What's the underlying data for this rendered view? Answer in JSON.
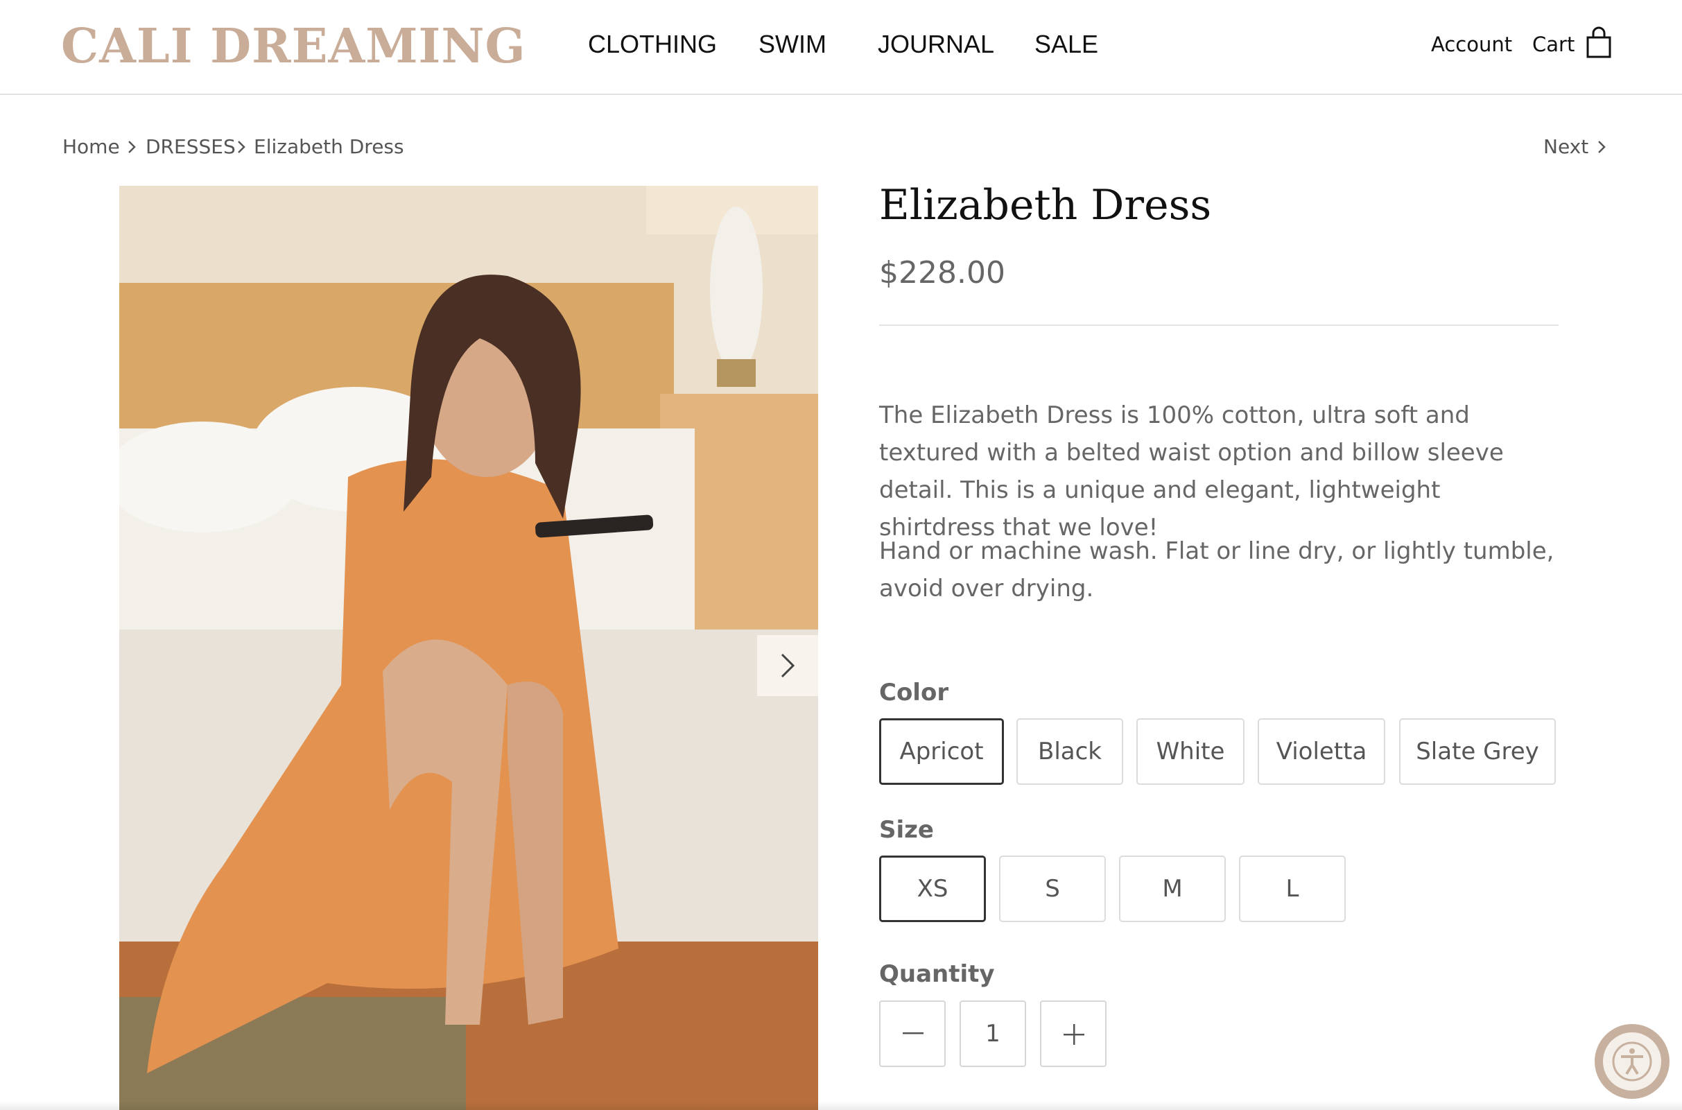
{
  "header": {
    "logo": "CALI DREAMING",
    "nav": [
      "CLOTHING",
      "SWIM",
      "JOURNAL",
      "SALE"
    ],
    "account_label": "Account",
    "cart_label": "Cart"
  },
  "breadcrumb": {
    "items": [
      "Home",
      "DRESSES",
      "Elizabeth Dress"
    ],
    "next_label": "Next"
  },
  "product": {
    "title": "Elizabeth Dress",
    "price": "$228.00",
    "description": [
      "The Elizabeth Dress is 100% cotton, ultra soft and textured with a belted waist option and billow sleeve detail. This is a unique and elegant, lightweight shirtdress that we love!",
      "Hand or machine wash. Flat or line dry, or lightly tumble, avoid over drying."
    ],
    "color_label": "Color",
    "colors": [
      "Apricot",
      "Black",
      "White",
      "Violetta",
      "Slate Grey"
    ],
    "selected_color": "Apricot",
    "size_label": "Size",
    "sizes": [
      "XS",
      "S",
      "M",
      "L"
    ],
    "selected_size": "XS",
    "quantity_label": "Quantity",
    "quantity": "1"
  },
  "colors": {
    "logo": "#c9ad98",
    "accent_border": "#333333",
    "text_muted": "#666666"
  },
  "icons": [
    "bag-icon",
    "chevron-right-icon",
    "minus-icon",
    "plus-icon",
    "accessibility-icon"
  ]
}
